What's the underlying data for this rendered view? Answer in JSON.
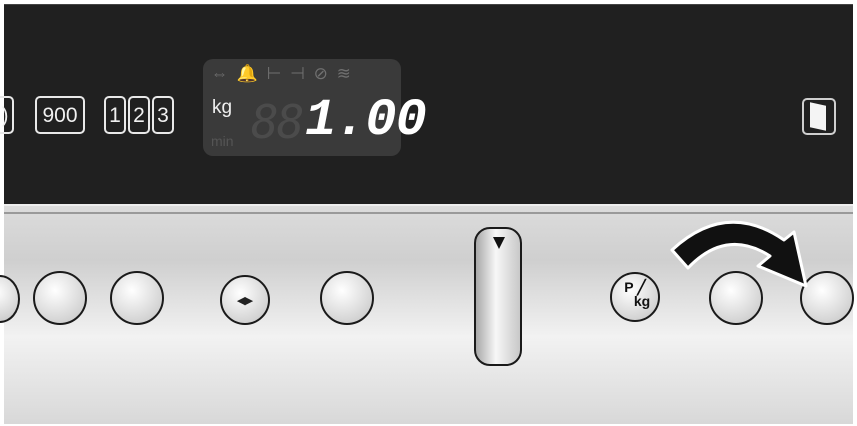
{
  "display": {
    "partial_button_label": ")",
    "spin_button_label": "900",
    "option_digits": [
      "1",
      "2",
      "3"
    ],
    "lcd": {
      "icons_text": "⇔ 🔔 ⊢ ⊣ ⊘ ≋",
      "unit_kg": "kg",
      "unit_min": "min",
      "ghost_digits": "88",
      "value": "1.00"
    }
  },
  "controls": {
    "dial_indicator": "▼",
    "arrows_button_symbol": "◂▸",
    "pkg_button_text_top": "P",
    "pkg_button_text_bottom": "kg",
    "pkg_button_slash": "╱"
  },
  "colors": {
    "display_bg": "#202020",
    "lcd_bg": "#3a3a3a",
    "panel_metal": "#d6d6d6"
  },
  "icons": {
    "door": "door-icon",
    "arrow": "curved-arrow-icon"
  }
}
